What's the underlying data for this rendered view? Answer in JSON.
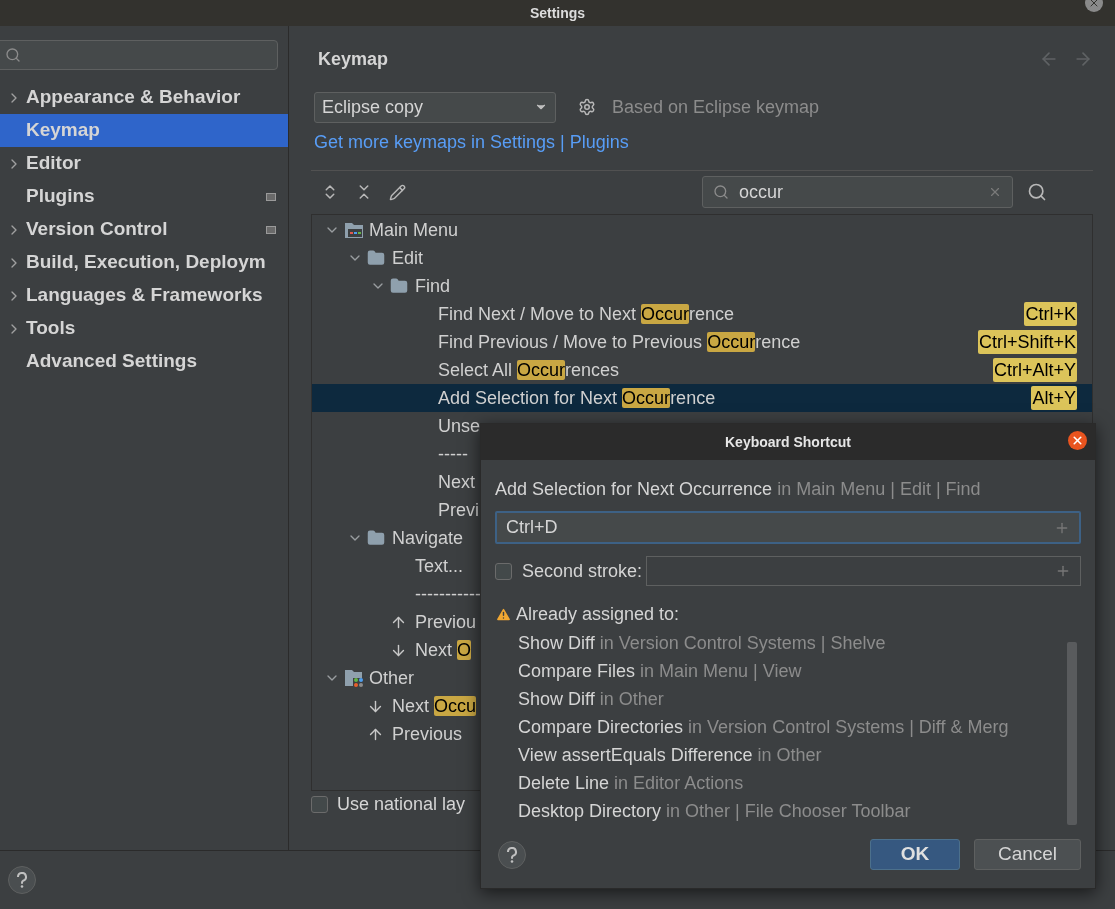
{
  "window": {
    "title": "Settings"
  },
  "sidebar": {
    "items": [
      {
        "label": "Appearance & Behavior",
        "expandable": true,
        "selected": false,
        "modified": false
      },
      {
        "label": "Keymap",
        "expandable": false,
        "selected": true,
        "modified": false
      },
      {
        "label": "Editor",
        "expandable": true,
        "selected": false,
        "modified": false
      },
      {
        "label": "Plugins",
        "expandable": false,
        "selected": false,
        "modified": true
      },
      {
        "label": "Version Control",
        "expandable": true,
        "selected": false,
        "modified": true
      },
      {
        "label": "Build, Execution, Deploym",
        "expandable": true,
        "selected": false,
        "modified": false
      },
      {
        "label": "Languages & Frameworks",
        "expandable": true,
        "selected": false,
        "modified": false
      },
      {
        "label": "Tools",
        "expandable": true,
        "selected": false,
        "modified": false
      },
      {
        "label": "Advanced Settings",
        "expandable": false,
        "selected": false,
        "modified": false
      }
    ]
  },
  "keymap": {
    "title": "Keymap",
    "scheme": "Eclipse copy",
    "based_on": "Based on Eclipse keymap",
    "link": "Get more keymaps in Settings | Plugins",
    "search": "occur",
    "tree": [
      {
        "kind": "menu",
        "label": "Main Menu",
        "expanded": true,
        "children": [
          {
            "kind": "folder",
            "label": "Edit",
            "expanded": true,
            "children": [
              {
                "kind": "folder",
                "label": "Find",
                "expanded": true,
                "children": [
                  {
                    "kind": "action",
                    "before": "Find Next / Move to Next ",
                    "match": "Occur",
                    "after": "rence",
                    "shortcut": "Ctrl+K",
                    "selected": false
                  },
                  {
                    "kind": "action",
                    "before": "Find Previous / Move to Previous ",
                    "match": "Occur",
                    "after": "rence",
                    "shortcut": "Ctrl+Shift+K",
                    "selected": false
                  },
                  {
                    "kind": "action",
                    "before": "Select All ",
                    "match": "Occur",
                    "after": "rences",
                    "shortcut": "Ctrl+Alt+Y",
                    "selected": false
                  },
                  {
                    "kind": "action",
                    "before": "Add Selection for Next ",
                    "match": "Occur",
                    "after": "rence",
                    "shortcut": "Alt+Y",
                    "selected": true
                  },
                  {
                    "kind": "action",
                    "before": "Unse",
                    "selected": false
                  },
                  {
                    "kind": "action",
                    "before": "-----",
                    "selected": false
                  },
                  {
                    "kind": "action",
                    "before": "Next",
                    "selected": false
                  },
                  {
                    "kind": "action",
                    "before": "Previ",
                    "selected": false
                  }
                ]
              }
            ]
          },
          {
            "kind": "folder",
            "label": "Navigate",
            "expanded": true,
            "children": [
              {
                "kind": "action",
                "before": "Text...",
                "selected": false
              },
              {
                "kind": "action",
                "before": "-----------",
                "selected": false
              },
              {
                "kind": "up",
                "before": "Previou",
                "selected": false
              },
              {
                "kind": "down",
                "before": "Next ",
                "match": "O",
                "selected": false
              }
            ]
          }
        ]
      },
      {
        "kind": "other",
        "label": "Other",
        "expanded": true,
        "children": [
          {
            "kind": "down",
            "before": "Next ",
            "match": "Occu",
            "selected": false
          },
          {
            "kind": "up",
            "before": "Previous",
            "selected": false
          }
        ]
      }
    ],
    "national_layout": {
      "label": "Use national lay",
      "checked": false
    }
  },
  "dialog": {
    "title": "Keyboard Shortcut",
    "action": "Add Selection for Next Occurrence",
    "location": "in Main Menu | Edit | Find",
    "first_stroke": "Ctrl+D",
    "second_stroke": {
      "label": "Second stroke:",
      "checked": false
    },
    "warning": "Already assigned to:",
    "conflicts": [
      {
        "name": "Show Diff",
        "location": "in Version Control Systems | Shelve"
      },
      {
        "name": "Compare Files",
        "location": "in Main Menu | View"
      },
      {
        "name": "Show Diff",
        "location": "in Other"
      },
      {
        "name": "Compare Directories",
        "location": "in Version Control Systems | Diff & Merg"
      },
      {
        "name": "View assertEquals Difference",
        "location": "in Other"
      },
      {
        "name": "Delete Line",
        "location": "in Editor Actions"
      },
      {
        "name": "Desktop Directory",
        "location": "in Other | File Chooser Toolbar"
      }
    ],
    "buttons": [
      {
        "label": "OK",
        "default": true
      },
      {
        "label": "Cancel",
        "default": false
      }
    ]
  }
}
